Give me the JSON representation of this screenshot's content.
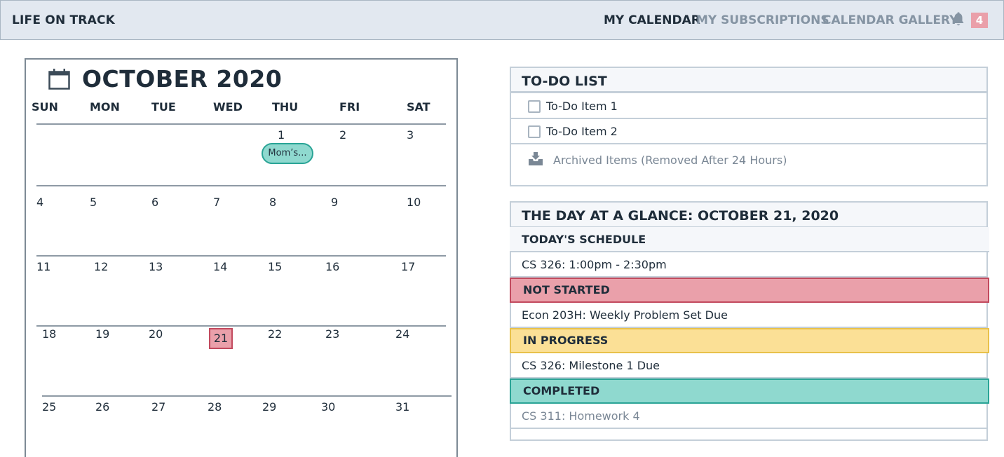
{
  "header": {
    "brand": "LIFE ON TRACK",
    "nav": {
      "my_calendar": "MY CALENDAR",
      "my_subscriptions": "MY SUBSCRIPTIONS",
      "calendar_gallery": "CALENDAR GALLERY"
    },
    "notifications_icon": "bell-icon",
    "notification_count": "4",
    "colors": {
      "bar": "#e2e8f0",
      "badge": "#eaa0aa",
      "muted_nav": "#8594a3"
    }
  },
  "calendar": {
    "icon": "calendar-icon",
    "title": "OCTOBER 2020",
    "weekdays": [
      "SUN",
      "MON",
      "TUE",
      "WED",
      "THU",
      "FRI",
      "SAT"
    ],
    "days": [
      "1",
      "2",
      "3",
      "4",
      "5",
      "6",
      "7",
      "8",
      "9",
      "10",
      "11",
      "12",
      "13",
      "14",
      "15",
      "16",
      "17",
      "18",
      "19",
      "20",
      "21",
      "22",
      "23",
      "24",
      "25",
      "26",
      "27",
      "28",
      "29",
      "30",
      "31"
    ],
    "today": "21",
    "event": {
      "day": "1",
      "label": "Mom’s..."
    },
    "colors": {
      "today_fill": "#eaa0aa",
      "today_border": "#c24a5e",
      "event_fill": "#8fd9cf",
      "event_border": "#2aa496"
    }
  },
  "todo": {
    "title": "TO-DO LIST",
    "items": [
      {
        "label": "To-Do Item 1",
        "checked": false
      },
      {
        "label": "To-Do Item 2",
        "checked": false
      }
    ],
    "archive_icon": "archive-tray-icon",
    "archive_label": "Archived Items (Removed After 24 Hours)"
  },
  "glance": {
    "title": "THE DAY AT A GLANCE: OCTOBER 21, 2020",
    "schedule_header": "TODAY'S SCHEDULE",
    "schedule_items": [
      "CS 326: 1:00pm - 2:30pm"
    ],
    "not_started_header": "NOT STARTED",
    "not_started_items": [
      "Econ 203H: Weekly Problem Set Due"
    ],
    "in_progress_header": "IN PROGRESS",
    "in_progress_items": [
      "CS 326: Milestone 1 Due"
    ],
    "completed_header": "COMPLETED",
    "completed_items": [
      "CS 311: Homework 4"
    ],
    "colors": {
      "schedule": "#f5f7fa",
      "not_started": "#eaa0aa",
      "not_started_border": "#c24a5e",
      "in_progress": "#fbe096",
      "in_progress_border": "#e8c14a",
      "completed": "#8fd9cf",
      "completed_border": "#2aa496"
    }
  }
}
